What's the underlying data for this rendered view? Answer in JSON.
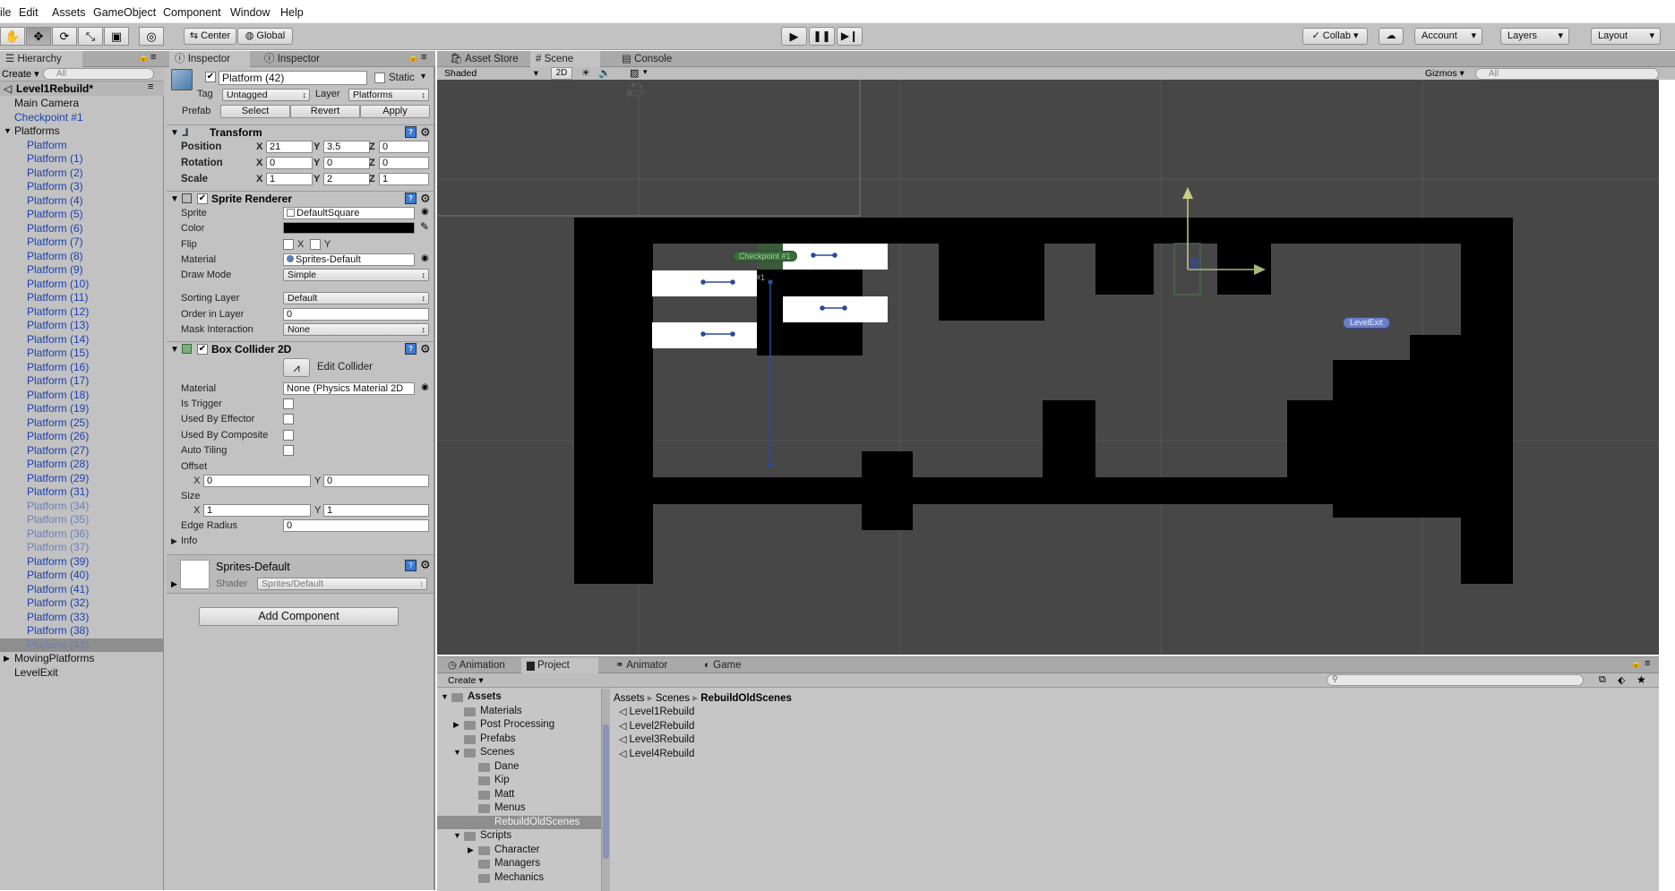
{
  "menu": [
    "ile",
    "Edit",
    "Assets",
    "GameObject",
    "Component",
    "Window",
    "Help"
  ],
  "toolbar": {
    "pivot_label": "Center",
    "space_label": "Global",
    "collab_label": "Collab",
    "account_label": "Account",
    "layers_label": "Layers",
    "layout_label": "Layout"
  },
  "hierarchy": {
    "tab_label": "Hierarchy",
    "create_label": "Create",
    "search_placeholder": "All",
    "scene_name": "Level1Rebuild*",
    "items": [
      {
        "label": "Main Camera",
        "indent": 1,
        "style": "dark"
      },
      {
        "label": "Checkpoint #1",
        "indent": 1,
        "style": "blue"
      },
      {
        "label": "Platforms",
        "indent": 1,
        "style": "dark",
        "expanded": true
      },
      {
        "label": "Platform",
        "indent": 2,
        "style": "blue"
      },
      {
        "label": "Platform (1)",
        "indent": 2,
        "style": "blue"
      },
      {
        "label": "Platform (2)",
        "indent": 2,
        "style": "blue"
      },
      {
        "label": "Platform (3)",
        "indent": 2,
        "style": "blue"
      },
      {
        "label": "Platform (4)",
        "indent": 2,
        "style": "blue"
      },
      {
        "label": "Platform (5)",
        "indent": 2,
        "style": "blue"
      },
      {
        "label": "Platform (6)",
        "indent": 2,
        "style": "blue"
      },
      {
        "label": "Platform (7)",
        "indent": 2,
        "style": "blue"
      },
      {
        "label": "Platform (8)",
        "indent": 2,
        "style": "blue"
      },
      {
        "label": "Platform (9)",
        "indent": 2,
        "style": "blue"
      },
      {
        "label": "Platform (10)",
        "indent": 2,
        "style": "blue"
      },
      {
        "label": "Platform (11)",
        "indent": 2,
        "style": "blue"
      },
      {
        "label": "Platform (12)",
        "indent": 2,
        "style": "blue"
      },
      {
        "label": "Platform (13)",
        "indent": 2,
        "style": "blue"
      },
      {
        "label": "Platform (14)",
        "indent": 2,
        "style": "blue"
      },
      {
        "label": "Platform (15)",
        "indent": 2,
        "style": "blue"
      },
      {
        "label": "Platform (16)",
        "indent": 2,
        "style": "blue"
      },
      {
        "label": "Platform (17)",
        "indent": 2,
        "style": "blue"
      },
      {
        "label": "Platform (18)",
        "indent": 2,
        "style": "blue"
      },
      {
        "label": "Platform (19)",
        "indent": 2,
        "style": "blue"
      },
      {
        "label": "Platform (25)",
        "indent": 2,
        "style": "blue"
      },
      {
        "label": "Platform (26)",
        "indent": 2,
        "style": "blue"
      },
      {
        "label": "Platform (27)",
        "indent": 2,
        "style": "blue"
      },
      {
        "label": "Platform (28)",
        "indent": 2,
        "style": "blue"
      },
      {
        "label": "Platform (29)",
        "indent": 2,
        "style": "blue"
      },
      {
        "label": "Platform (31)",
        "indent": 2,
        "style": "blue"
      },
      {
        "label": "Platform (34)",
        "indent": 2,
        "style": "gray"
      },
      {
        "label": "Platform (35)",
        "indent": 2,
        "style": "gray"
      },
      {
        "label": "Platform (36)",
        "indent": 2,
        "style": "gray"
      },
      {
        "label": "Platform (37)",
        "indent": 2,
        "style": "gray"
      },
      {
        "label": "Platform (39)",
        "indent": 2,
        "style": "blue"
      },
      {
        "label": "Platform (40)",
        "indent": 2,
        "style": "blue"
      },
      {
        "label": "Platform (41)",
        "indent": 2,
        "style": "blue"
      },
      {
        "label": "Platform (32)",
        "indent": 2,
        "style": "blue"
      },
      {
        "label": "Platform (33)",
        "indent": 2,
        "style": "blue"
      },
      {
        "label": "Platform (38)",
        "indent": 2,
        "style": "blue"
      },
      {
        "label": "Platform (42)",
        "indent": 2,
        "style": "gray",
        "selected": true
      },
      {
        "label": "MovingPlatforms",
        "indent": 1,
        "style": "dark",
        "collapsed": true
      },
      {
        "label": "LevelExit",
        "indent": 1,
        "style": "dark"
      }
    ]
  },
  "inspector": {
    "tab1": "Inspector",
    "tab2": "Inspector",
    "object_name": "Platform (42)",
    "static_label": "Static",
    "tag_label": "Tag",
    "tag_value": "Untagged",
    "layer_label": "Layer",
    "layer_value": "Platforms",
    "prefab_label": "Prefab",
    "prefab_buttons": [
      "Select",
      "Revert",
      "Apply"
    ],
    "transform": {
      "title": "Transform",
      "position_label": "Position",
      "pos": {
        "x": "21",
        "y": "3.5",
        "z": "0"
      },
      "rotation_label": "Rotation",
      "rot": {
        "x": "0",
        "y": "0",
        "z": "0"
      },
      "scale_label": "Scale",
      "scale": {
        "x": "1",
        "y": "2",
        "z": "1"
      }
    },
    "sprite_renderer": {
      "title": "Sprite Renderer",
      "sprite_label": "Sprite",
      "sprite_value": "DefaultSquare",
      "color_label": "Color",
      "flip_label": "Flip",
      "flip_x": "X",
      "flip_y": "Y",
      "material_label": "Material",
      "material_value": "Sprites-Default",
      "drawmode_label": "Draw Mode",
      "drawmode_value": "Simple",
      "sorting_label": "Sorting Layer",
      "sorting_value": "Default",
      "order_label": "Order in Layer",
      "order_value": "0",
      "mask_label": "Mask Interaction",
      "mask_value": "None"
    },
    "box_collider": {
      "title": "Box Collider 2D",
      "edit_label": "Edit Collider",
      "material_label": "Material",
      "material_value": "None (Physics Material 2D",
      "trigger_label": "Is Trigger",
      "effector_label": "Used By Effector",
      "composite_label": "Used By Composite",
      "tiling_label": "Auto Tiling",
      "offset_label": "Offset",
      "offset": {
        "x": "0",
        "y": "0"
      },
      "size_label": "Size",
      "size": {
        "x": "1",
        "y": "1"
      },
      "edge_label": "Edge Radius",
      "edge_value": "0",
      "info_label": "Info"
    },
    "material_block": {
      "name": "Sprites-Default",
      "shader_label": "Shader",
      "shader_value": "Sprites/Default"
    },
    "add_component": "Add Component"
  },
  "scene": {
    "tabs": [
      "Asset Store",
      "Scene",
      "Console"
    ],
    "shading": "Shaded",
    "mode_2d": "2D",
    "gizmos": "Gizmos",
    "search_placeholder": "All",
    "checkpoint_label": "Checkpoint #1",
    "checkpoint_tag": "#1",
    "levelexit_label": "LevelExit"
  },
  "project": {
    "tabs": [
      "Animation",
      "Project",
      "Animator",
      "Game"
    ],
    "create_label": "Create",
    "breadcrumb": [
      "Assets",
      "Scenes",
      "RebuildOldScenes"
    ],
    "tree": [
      {
        "label": "Assets",
        "indent": 0,
        "arrow": "open",
        "bold": true
      },
      {
        "label": "Materials",
        "indent": 1,
        "arrow": ""
      },
      {
        "label": "Post Processing",
        "indent": 1,
        "arrow": "closed"
      },
      {
        "label": "Prefabs",
        "indent": 1,
        "arrow": ""
      },
      {
        "label": "Scenes",
        "indent": 1,
        "arrow": "open"
      },
      {
        "label": "Dane",
        "indent": 2,
        "arrow": ""
      },
      {
        "label": "Kip",
        "indent": 2,
        "arrow": ""
      },
      {
        "label": "Matt",
        "indent": 2,
        "arrow": ""
      },
      {
        "label": "Menus",
        "indent": 2,
        "arrow": ""
      },
      {
        "label": "RebuildOldScenes",
        "indent": 2,
        "arrow": "",
        "selected": true
      },
      {
        "label": "Scripts",
        "indent": 1,
        "arrow": "open"
      },
      {
        "label": "Character",
        "indent": 2,
        "arrow": "closed"
      },
      {
        "label": "Managers",
        "indent": 2,
        "arrow": ""
      },
      {
        "label": "Mechanics",
        "indent": 2,
        "arrow": ""
      }
    ],
    "files": [
      "Level1Rebuild",
      "Level2Rebuild",
      "Level3Rebuild",
      "Level4Rebuild"
    ]
  },
  "colors": {
    "editor_bg": "#c2c2c2",
    "scene_bg": "#474747",
    "selection": "#8e8e8e",
    "hierarchy_prefab_blue": "#1b3fb0"
  }
}
